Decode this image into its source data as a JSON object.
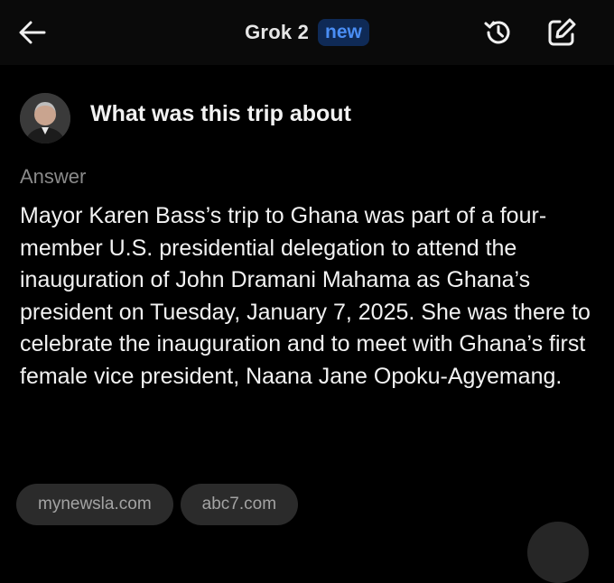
{
  "header": {
    "back_icon": "arrow-left-icon",
    "title": "Grok 2",
    "badge": "new",
    "history_icon": "history-icon",
    "edit_icon": "edit-icon"
  },
  "conversation": {
    "question": "What was this trip about",
    "answer_label": "Answer",
    "answer_text": "Mayor Karen Bass’s trip to Ghana was part of a four-member U.S. presidential delegation to attend the inauguration of John Dramani Mahama as Ghana’s president on Tuesday, January 7, 2025. She was there to celebrate the inauguration and to meet with Ghana’s first female vice president, Naana Jane Opoku-Agyemang.",
    "sources": [
      "mynewsla.com",
      "abc7.com"
    ]
  },
  "colors": {
    "background": "#000000",
    "badge_bg": "#0f2a56",
    "badge_text": "#4a8ef5",
    "muted_text": "#8a8a8a",
    "chip_bg": "#2b2b2b"
  }
}
